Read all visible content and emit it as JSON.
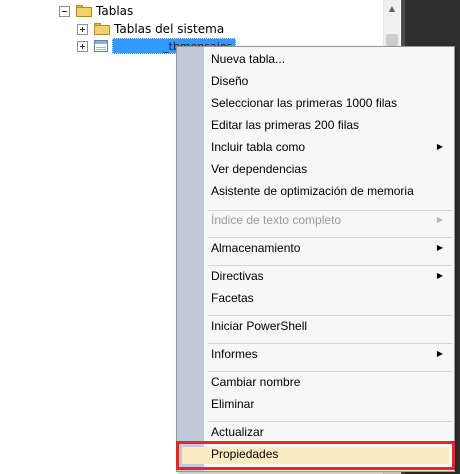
{
  "tree": {
    "tables_label": "Tablas",
    "system_tables_label": "Tablas del sistema",
    "selected_table_label": "_tbmensajes"
  },
  "context_menu": {
    "items": [
      {
        "label": "Nueva tabla..."
      },
      {
        "label": "Diseño"
      },
      {
        "label": "Seleccionar las primeras 1000 filas"
      },
      {
        "label": "Editar las primeras 200 filas"
      },
      {
        "label": "Incluir tabla como",
        "submenu": true
      },
      {
        "label": "Ver dependencias"
      },
      {
        "label": "Asistente de optimización de memoria"
      },
      {
        "label": "Índice de texto completo",
        "submenu": true,
        "disabled": true
      },
      {
        "label": "Almacenamiento",
        "submenu": true
      },
      {
        "label": "Directivas",
        "submenu": true
      },
      {
        "label": "Facetas"
      },
      {
        "label": "Iniciar PowerShell"
      },
      {
        "label": "Informes",
        "submenu": true
      },
      {
        "label": "Cambiar nombre"
      },
      {
        "label": "Eliminar"
      },
      {
        "label": "Actualizar"
      },
      {
        "label": "Propiedades",
        "highlighted": true
      }
    ]
  },
  "colors": {
    "selection": "#3399ff",
    "highlight_border": "#e02a2a",
    "highlight_fill": "#fcecc4",
    "menu_gutter": "#c0c9d8"
  }
}
